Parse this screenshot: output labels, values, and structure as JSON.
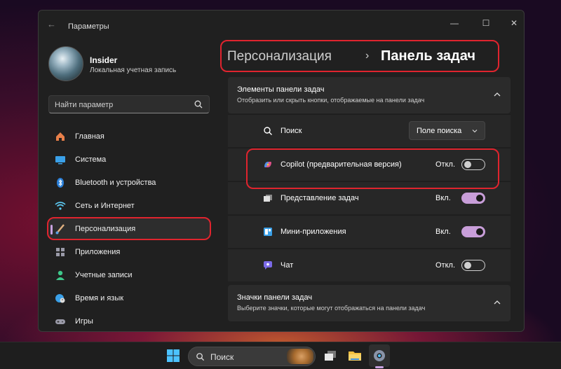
{
  "window": {
    "app_title": "Параметры",
    "back_icon": "arrow-left-icon",
    "controls": [
      "minimize-icon",
      "maximize-icon",
      "close-icon"
    ]
  },
  "profile": {
    "name": "Insider",
    "account_type": "Локальная учетная запись"
  },
  "search": {
    "placeholder": "Найти параметр"
  },
  "sidebar": {
    "items": [
      {
        "label": "Главная",
        "icon": "home-icon",
        "color": "#e8804a"
      },
      {
        "label": "Система",
        "icon": "monitor-icon",
        "color": "#3aa0e8"
      },
      {
        "label": "Bluetooth и устройства",
        "icon": "bluetooth-icon",
        "color": "#2a7fd8"
      },
      {
        "label": "Сеть и Интернет",
        "icon": "wifi-icon",
        "color": "#5cc8f0"
      },
      {
        "label": "Персонализация",
        "icon": "brush-icon",
        "color": "#e0b080",
        "active": true
      },
      {
        "label": "Приложения",
        "icon": "apps-icon",
        "color": "#9a9aa8"
      },
      {
        "label": "Учетные записи",
        "icon": "person-icon",
        "color": "#3ec78a"
      },
      {
        "label": "Время и язык",
        "icon": "globe-clock-icon",
        "color": "#3aa0e8"
      },
      {
        "label": "Игры",
        "icon": "gamepad-icon",
        "color": "#9a9aa8"
      }
    ]
  },
  "breadcrumb": {
    "parent": "Персонализация",
    "separator": "›",
    "current": "Панель задач"
  },
  "taskbar_items_group": {
    "title": "Элементы панели задач",
    "description": "Отобразить или скрыть кнопки, отображаемые на панели задач",
    "rows": [
      {
        "label": "Поиск",
        "icon": "search-icon",
        "control": "dropdown",
        "value": "Поле поиска"
      },
      {
        "label": "Copilot (предварительная версия)",
        "icon": "copilot-icon",
        "control": "toggle",
        "state": "Откл.",
        "on": false
      },
      {
        "label": "Представление задач",
        "icon": "task-view-icon",
        "control": "toggle",
        "state": "Вкл.",
        "on": true
      },
      {
        "label": "Мини-приложения",
        "icon": "widgets-icon",
        "control": "toggle",
        "state": "Вкл.",
        "on": true
      },
      {
        "label": "Чат",
        "icon": "chat-icon",
        "control": "toggle",
        "state": "Откл.",
        "on": false
      }
    ]
  },
  "taskbar_icons_group": {
    "title": "Значки панели задач",
    "description": "Выберите значки, которые могут отображаться на панели задач"
  },
  "os_taskbar": {
    "search_label": "Поиск",
    "apps": [
      "windows-start-icon",
      "task-view-icon",
      "file-explorer-icon",
      "settings-icon"
    ]
  },
  "colors": {
    "accent": "#c89ed9",
    "highlight": "#e0242e",
    "window_bg": "#202020",
    "card_bg": "#2b2b2b"
  }
}
